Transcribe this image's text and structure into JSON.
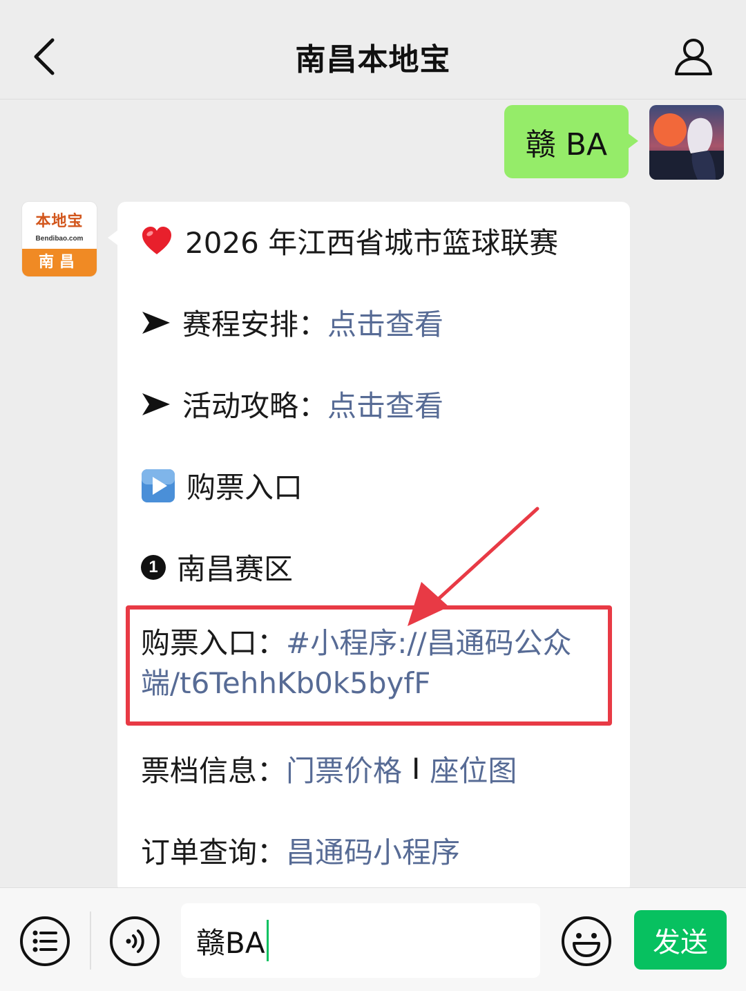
{
  "header": {
    "title": "南昌本地宝",
    "back_icon": "chevron-left-icon",
    "profile_icon": "person-icon"
  },
  "sent_message": {
    "text": "赣 BA"
  },
  "account_avatar": {
    "brand_name": "本地宝",
    "brand_domain": "Bendibao.com",
    "city": "南昌"
  },
  "received_message": {
    "title": "2026 年江西省城市篮球联赛",
    "schedule": {
      "label": "赛程安排：",
      "link": "点击查看"
    },
    "guide": {
      "label": "活动攻略：",
      "link": "点击查看"
    },
    "ticket_heading": "购票入口",
    "region_number": "1",
    "region": "南昌赛区",
    "ticket_entry": {
      "label": "购票入口：",
      "link": "#小程序://昌通码公众端/t6TehhKb0k5byfF"
    },
    "ticket_info": {
      "label": "票档信息：",
      "link1": "门票价格",
      "separator": "I",
      "link2": "座位图"
    },
    "order_query": {
      "label": "订单查询：",
      "link": "昌通码小程序"
    }
  },
  "input_bar": {
    "input_value": "赣BA",
    "send_label": "发送",
    "menu_icon": "list-menu-icon",
    "voice_icon": "voice-icon",
    "emoji_icon": "emoji-icon"
  },
  "colors": {
    "background": "#ededed",
    "sent_bubble": "#95ec69",
    "link": "#576b95",
    "highlight": "#e83a45",
    "send_button": "#07c160"
  }
}
